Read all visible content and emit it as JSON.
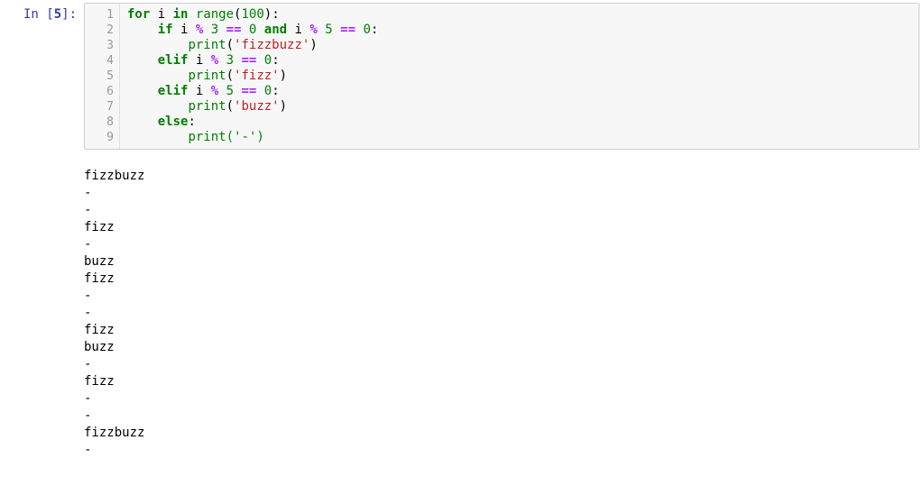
{
  "prompt": {
    "label": "In [",
    "num": "5",
    "close": "]:"
  },
  "code": {
    "line_numbers": [
      "1",
      "2",
      "3",
      "4",
      "5",
      "6",
      "7",
      "8",
      "9"
    ],
    "lines": [
      [
        {
          "cls": "tok-kw",
          "t": "for"
        },
        {
          "cls": "tok-id",
          "t": " i "
        },
        {
          "cls": "tok-kw",
          "t": "in"
        },
        {
          "cls": "tok-id",
          "t": " "
        },
        {
          "cls": "tok-builtin",
          "t": "range"
        },
        {
          "cls": "tok-pun",
          "t": "("
        },
        {
          "cls": "tok-num",
          "t": "100"
        },
        {
          "cls": "tok-pun",
          "t": "):"
        }
      ],
      [
        {
          "cls": "tok-id",
          "t": "    "
        },
        {
          "cls": "tok-kw",
          "t": "if"
        },
        {
          "cls": "tok-id",
          "t": " i "
        },
        {
          "cls": "tok-op",
          "t": "%"
        },
        {
          "cls": "tok-id",
          "t": " "
        },
        {
          "cls": "tok-num",
          "t": "3"
        },
        {
          "cls": "tok-id",
          "t": " "
        },
        {
          "cls": "tok-op",
          "t": "=="
        },
        {
          "cls": "tok-id",
          "t": " "
        },
        {
          "cls": "tok-num",
          "t": "0"
        },
        {
          "cls": "tok-id",
          "t": " "
        },
        {
          "cls": "tok-kw",
          "t": "and"
        },
        {
          "cls": "tok-id",
          "t": " i "
        },
        {
          "cls": "tok-op",
          "t": "%"
        },
        {
          "cls": "tok-id",
          "t": " "
        },
        {
          "cls": "tok-num",
          "t": "5"
        },
        {
          "cls": "tok-id",
          "t": " "
        },
        {
          "cls": "tok-op",
          "t": "=="
        },
        {
          "cls": "tok-id",
          "t": " "
        },
        {
          "cls": "tok-num",
          "t": "0"
        },
        {
          "cls": "tok-pun",
          "t": ":"
        }
      ],
      [
        {
          "cls": "tok-id",
          "t": "        "
        },
        {
          "cls": "tok-builtin",
          "t": "print"
        },
        {
          "cls": "tok-pun",
          "t": "("
        },
        {
          "cls": "tok-str",
          "t": "'fizzbuzz'"
        },
        {
          "cls": "tok-pun",
          "t": ")"
        }
      ],
      [
        {
          "cls": "tok-id",
          "t": "    "
        },
        {
          "cls": "tok-kw",
          "t": "elif"
        },
        {
          "cls": "tok-id",
          "t": " i "
        },
        {
          "cls": "tok-op",
          "t": "%"
        },
        {
          "cls": "tok-id",
          "t": " "
        },
        {
          "cls": "tok-num",
          "t": "3"
        },
        {
          "cls": "tok-id",
          "t": " "
        },
        {
          "cls": "tok-op",
          "t": "=="
        },
        {
          "cls": "tok-id",
          "t": " "
        },
        {
          "cls": "tok-num",
          "t": "0"
        },
        {
          "cls": "tok-pun",
          "t": ":"
        }
      ],
      [
        {
          "cls": "tok-id",
          "t": "        "
        },
        {
          "cls": "tok-builtin",
          "t": "print"
        },
        {
          "cls": "tok-pun",
          "t": "("
        },
        {
          "cls": "tok-str",
          "t": "'fizz'"
        },
        {
          "cls": "tok-pun",
          "t": ")"
        }
      ],
      [
        {
          "cls": "tok-id",
          "t": "    "
        },
        {
          "cls": "tok-kw",
          "t": "elif"
        },
        {
          "cls": "tok-id",
          "t": " i "
        },
        {
          "cls": "tok-op",
          "t": "%"
        },
        {
          "cls": "tok-id",
          "t": " "
        },
        {
          "cls": "tok-num",
          "t": "5"
        },
        {
          "cls": "tok-id",
          "t": " "
        },
        {
          "cls": "tok-op",
          "t": "=="
        },
        {
          "cls": "tok-id",
          "t": " "
        },
        {
          "cls": "tok-num",
          "t": "0"
        },
        {
          "cls": "tok-pun",
          "t": ":"
        }
      ],
      [
        {
          "cls": "tok-id",
          "t": "        "
        },
        {
          "cls": "tok-builtin",
          "t": "print"
        },
        {
          "cls": "tok-pun",
          "t": "("
        },
        {
          "cls": "tok-str",
          "t": "'buzz'"
        },
        {
          "cls": "tok-pun",
          "t": ")"
        }
      ],
      [
        {
          "cls": "tok-id",
          "t": "    "
        },
        {
          "cls": "tok-kw",
          "t": "else"
        },
        {
          "cls": "tok-pun",
          "t": ":"
        }
      ],
      [
        {
          "cls": "tok-id",
          "t": "        "
        },
        {
          "cls": "tok-builtin",
          "t": "print"
        },
        {
          "cls": "tok-pun",
          "t": "("
        },
        {
          "cls": "tok-str",
          "t": "'-'"
        },
        {
          "cls": "tok-pun",
          "t": ")"
        }
      ]
    ],
    "cursor_line_index": 8
  },
  "output_lines": [
    "fizzbuzz",
    "-",
    "-",
    "fizz",
    "-",
    "buzz",
    "fizz",
    "-",
    "-",
    "fizz",
    "buzz",
    "-",
    "fizz",
    "-",
    "-",
    "fizzbuzz",
    "-"
  ]
}
